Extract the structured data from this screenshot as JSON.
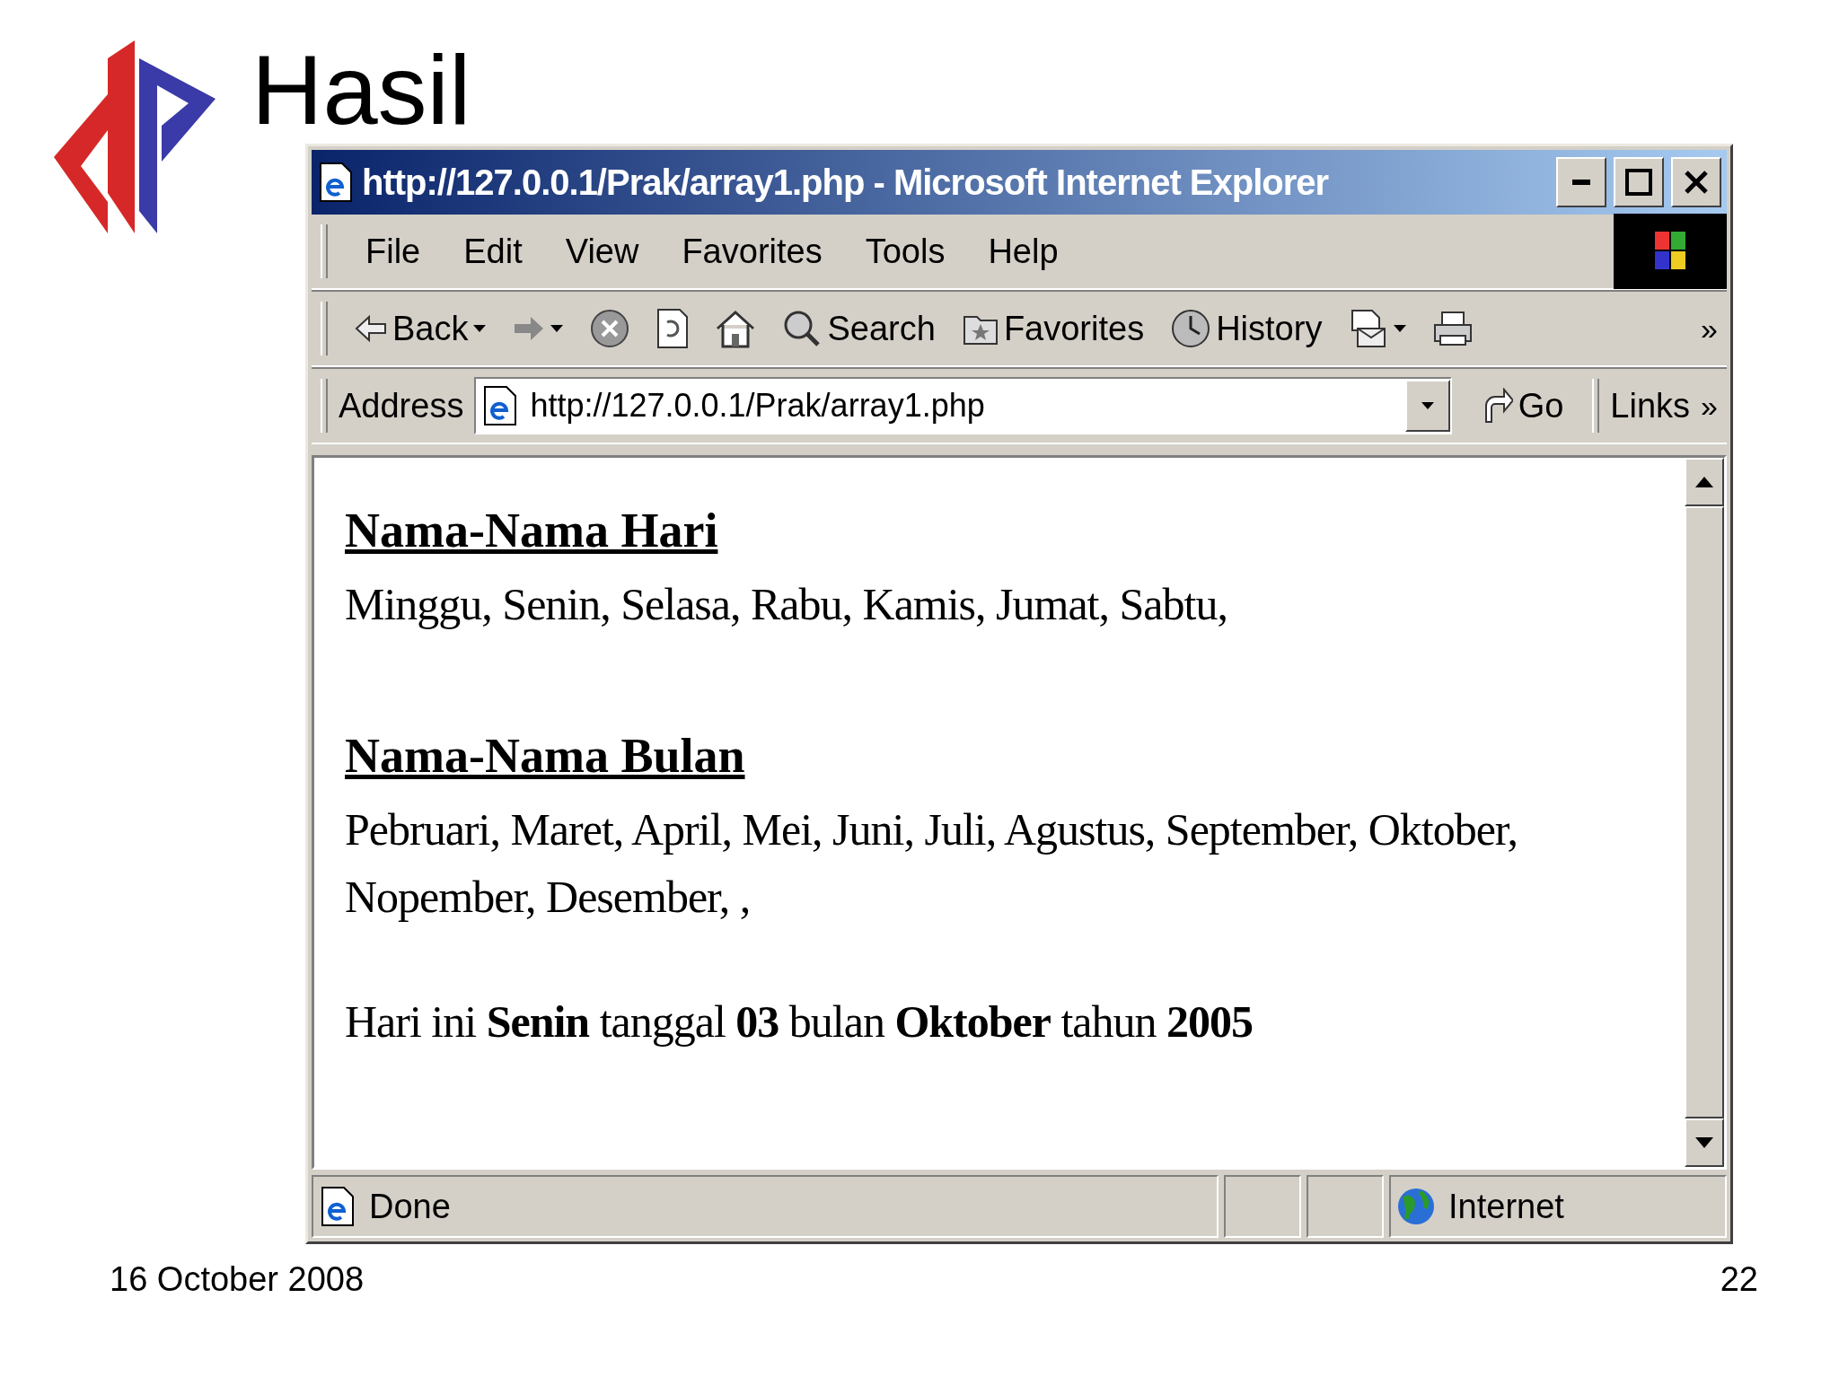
{
  "slide": {
    "title": "Hasil",
    "date": "16 October 2008",
    "page": "22"
  },
  "window": {
    "title": "http://127.0.0.1/Prak/array1.php - Microsoft Internet Explorer"
  },
  "menu": [
    "File",
    "Edit",
    "View",
    "Favorites",
    "Tools",
    "Help"
  ],
  "toolbar": [
    {
      "kind": "back",
      "label": "Back"
    },
    {
      "kind": "forward"
    },
    {
      "kind": "stop"
    },
    {
      "kind": "refresh"
    },
    {
      "kind": "home"
    },
    {
      "kind": "search",
      "label": "Search"
    },
    {
      "kind": "favorites",
      "label": "Favorites"
    },
    {
      "kind": "history",
      "label": "History"
    },
    {
      "kind": "mail"
    },
    {
      "kind": "print"
    }
  ],
  "toolbar_more": "»",
  "address": {
    "label": "Address",
    "value": "http://127.0.0.1/Prak/array1.php",
    "go": "Go",
    "links": "Links",
    "links_more": "»"
  },
  "content": [
    {
      "kind": "heading",
      "text": "Nama-Nama Hari"
    },
    {
      "kind": "paragraph",
      "text": "Minggu, Senin, Selasa, Rabu, Kamis, Jumat, Sabtu,"
    },
    {
      "kind": "heading",
      "text": "Nama-Nama Bulan"
    },
    {
      "kind": "paragraph",
      "text": "Pebruari, Maret, April, Mei, Juni, Juli, Agustus, September, Oktober, Nopember, Desember, ,"
    },
    {
      "kind": "paragraph",
      "text": "Hari ini **Senin** tanggal **03** bulan **Oktober** tahun **2005**"
    }
  ],
  "status": {
    "text": "Done",
    "zone": "Internet"
  }
}
